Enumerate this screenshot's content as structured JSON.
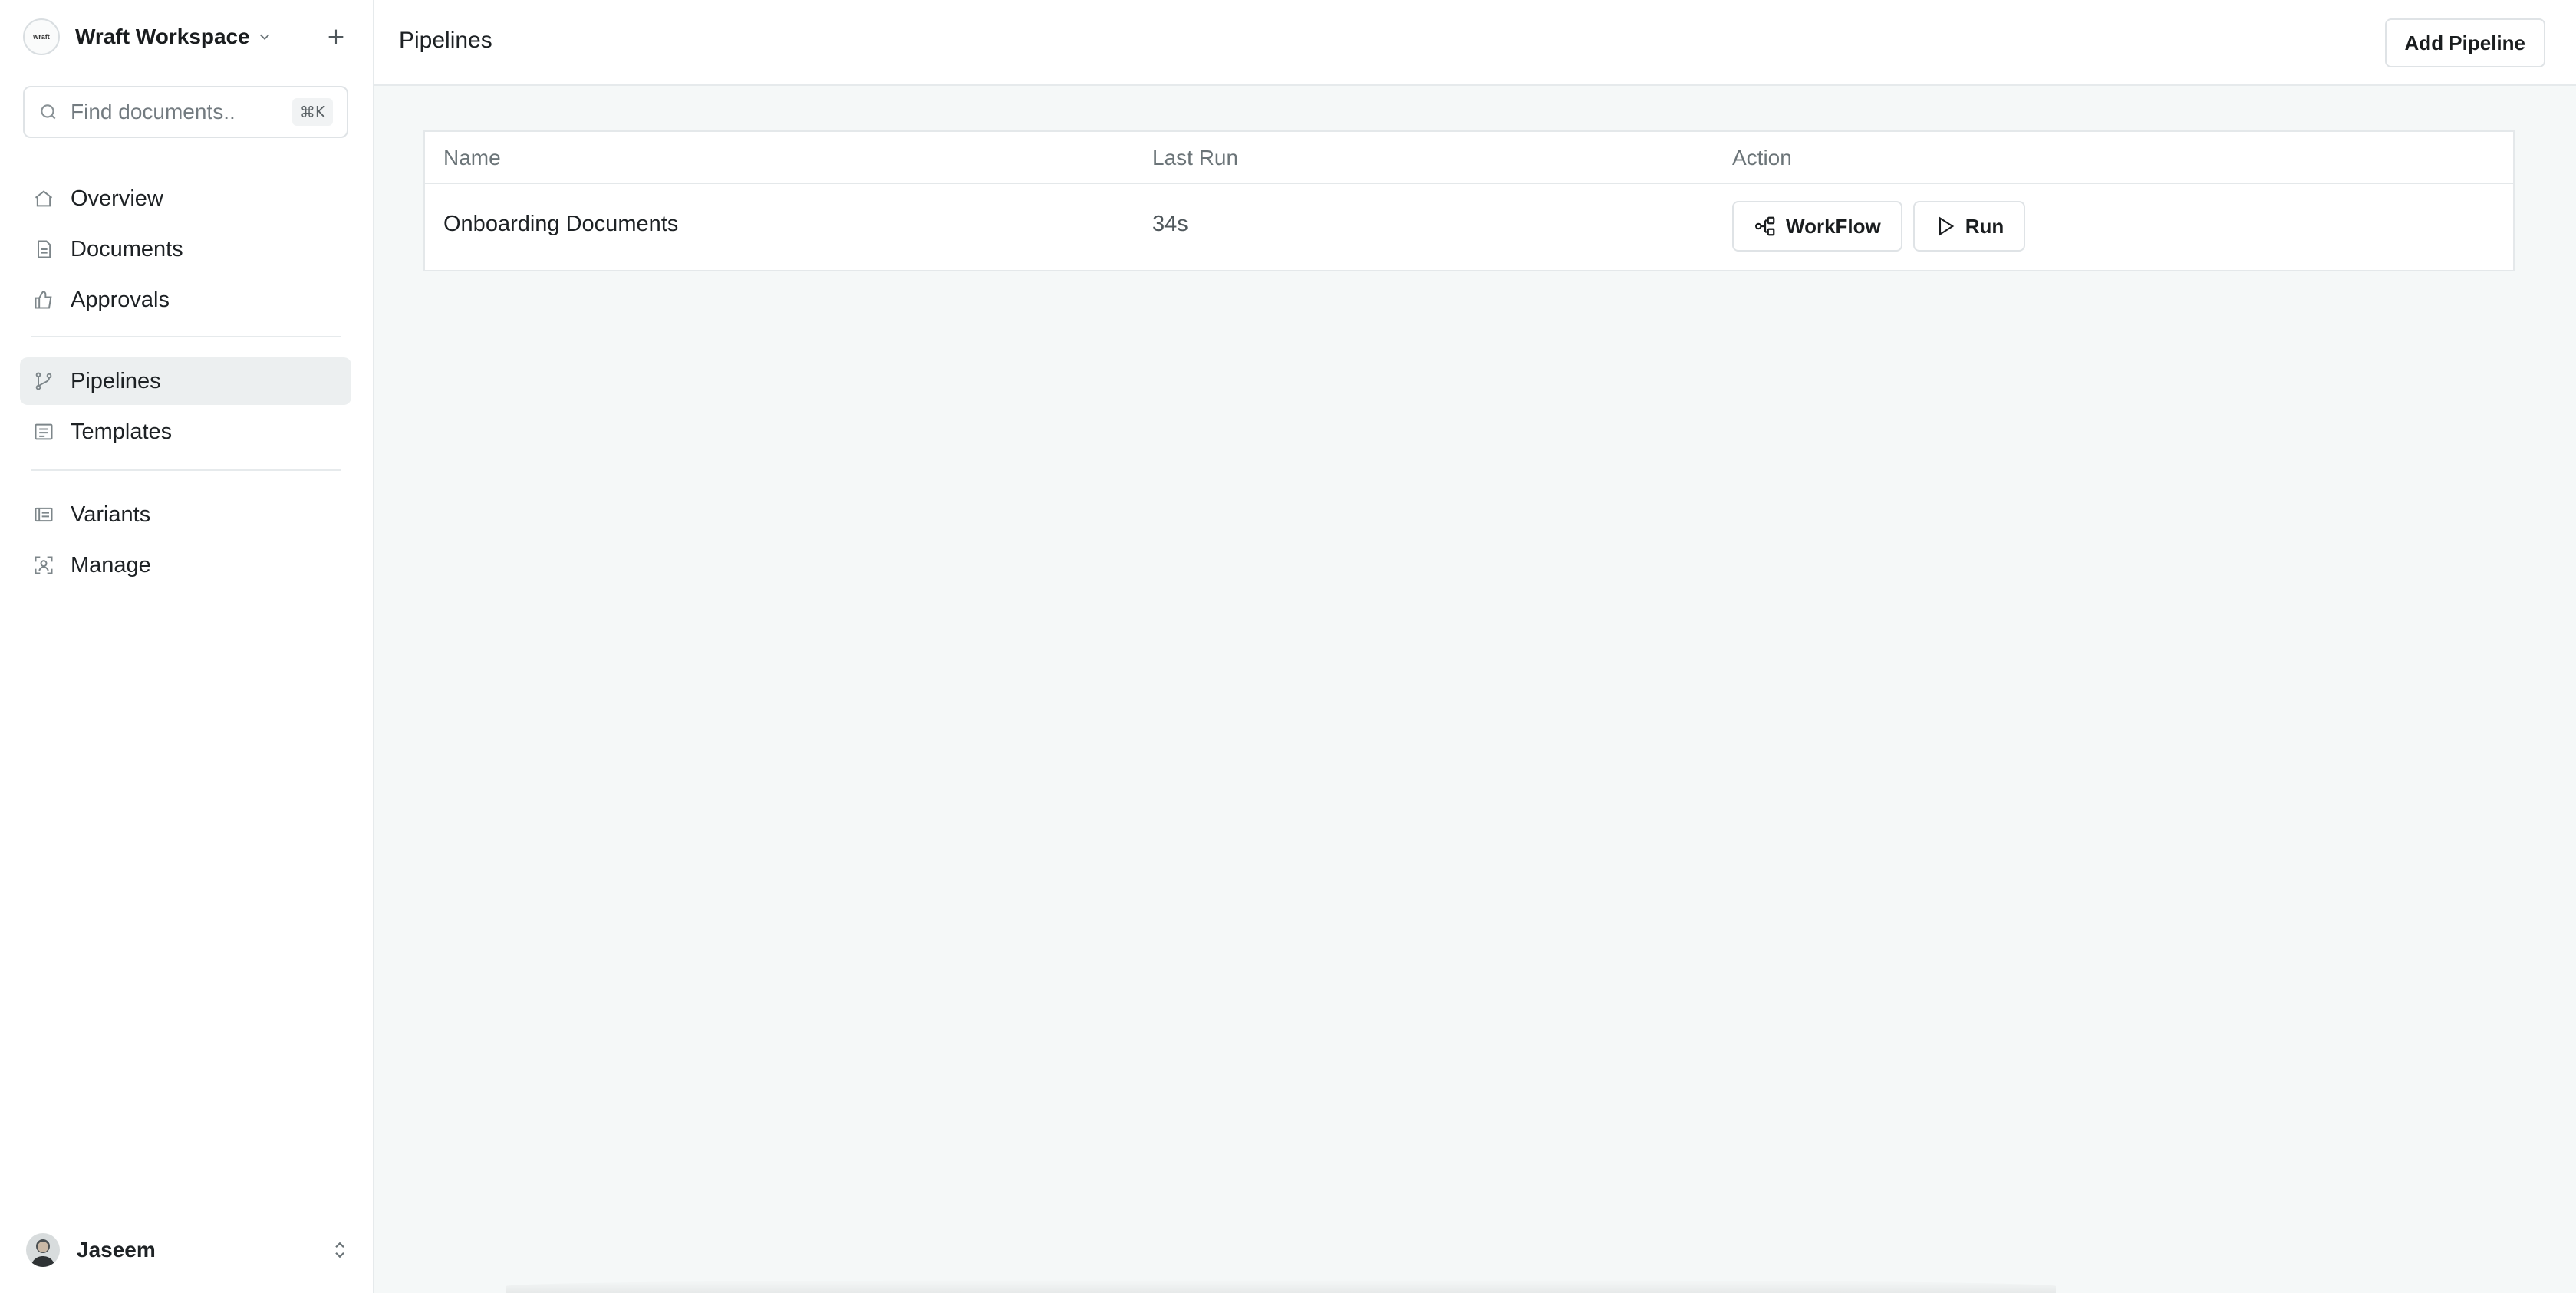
{
  "workspace": {
    "name": "Wraft Workspace",
    "logo_text": "wraft"
  },
  "search": {
    "placeholder": "Find documents..",
    "shortcut": "⌘K"
  },
  "sidebar": {
    "primary": [
      {
        "label": "Overview",
        "icon": "home-icon"
      },
      {
        "label": "Documents",
        "icon": "document-icon"
      },
      {
        "label": "Approvals",
        "icon": "thumbs-up-icon"
      }
    ],
    "secondary": [
      {
        "label": "Pipelines",
        "icon": "git-branch-icon",
        "active": true
      },
      {
        "label": "Templates",
        "icon": "template-icon"
      }
    ],
    "tertiary": [
      {
        "label": "Variants",
        "icon": "variants-icon"
      },
      {
        "label": "Manage",
        "icon": "manage-icon"
      }
    ]
  },
  "user": {
    "name": "Jaseem"
  },
  "header": {
    "title": "Pipelines",
    "add_button": "Add Pipeline"
  },
  "table": {
    "columns": [
      "Name",
      "Last Run",
      "Action"
    ],
    "rows": [
      {
        "name": "Onboarding Documents",
        "last_run": "34s",
        "actions": {
          "workflow": "WorkFlow",
          "run": "Run"
        }
      }
    ]
  },
  "colors": {
    "background": "#f5f8f8",
    "sidebar": "#ffffff",
    "active_item": "#eceff0",
    "border": "#e4e8ea"
  }
}
